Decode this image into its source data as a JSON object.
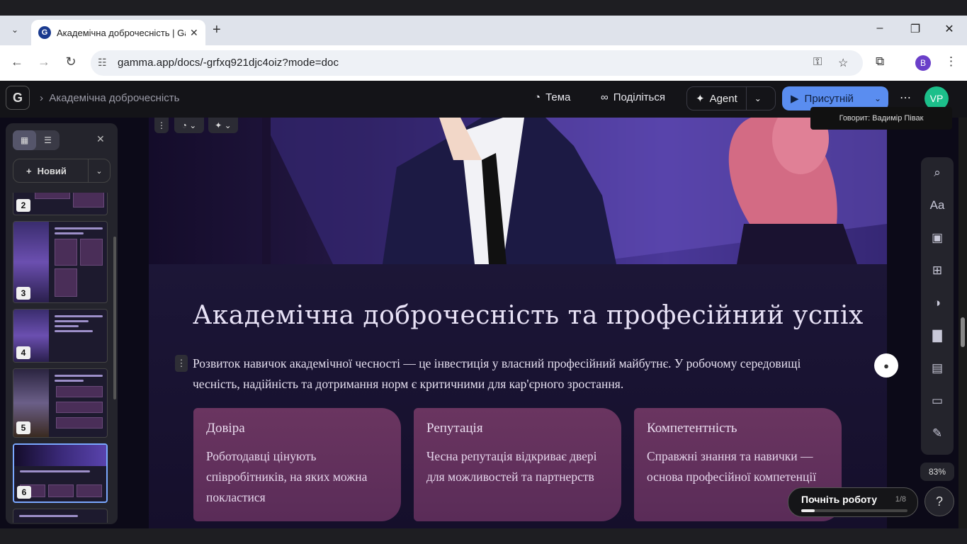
{
  "browser": {
    "tab_title": "Академічна доброчесність | Gamma",
    "favicon_letter": "G",
    "url": "gamma.app/docs/-grfxq921djc4oiz?mode=doc",
    "profile_initial": "B",
    "icons": [
      "tab-dropdown-icon",
      "close-tab-icon",
      "new-tab-icon",
      "minimize-icon",
      "maximize-icon",
      "close-window-icon",
      "back-icon",
      "forward-icon",
      "reload-icon",
      "site-info-icon",
      "password-key-icon",
      "bookmark-star-icon",
      "extensions-icon",
      "menu-icon"
    ]
  },
  "app_header": {
    "logo": "G",
    "breadcrumb": "Академічна доброчесність",
    "theme_label": "Тема",
    "share_label": "Поділіться",
    "agent_label": "Agent",
    "present_label": "Присутній",
    "user_initials": "VP",
    "tooltip": "Говорит: Вадимір Півак"
  },
  "sidebar": {
    "new_label": "Новий",
    "thumbnails": [
      {
        "num": "2"
      },
      {
        "num": "3"
      },
      {
        "num": "4"
      },
      {
        "num": "5"
      },
      {
        "num": "6",
        "active": true
      }
    ]
  },
  "doc": {
    "title": "Академічна доброчесність та професійний успіх",
    "intro": "Розвиток навичок академічної чесності — це інвестиція у власний професійний майбутнє. У робочому середовищі чесність, надійність та дотримання норм є критичними для кар'єрного зростання.",
    "cards": [
      {
        "title": "Довіра",
        "body": "Роботодавці цінують співробітників, на яких можна покластися"
      },
      {
        "title": "Репутація",
        "body": "Чесна репутація відкриває двері для можливостей та партнерств"
      },
      {
        "title": "Компетентність",
        "body": "Справжні знання та навички — основа професійної компетенції"
      }
    ]
  },
  "right_tools": {
    "icons": [
      "search-icon",
      "text-style-icon",
      "image-icon",
      "add-block-icon",
      "theme-toggle-icon",
      "chart-icon",
      "video-icon",
      "card-layout-icon",
      "edit-icon"
    ],
    "zoom": "83%",
    "help": "?"
  },
  "onboarding": {
    "label": "Почніть роботу",
    "progress_text": "1/8",
    "progress": 0.125
  },
  "colors": {
    "accent": "#5a8df0",
    "user_avatar": "#1cbf8a",
    "card_bg": "#6a3560"
  }
}
